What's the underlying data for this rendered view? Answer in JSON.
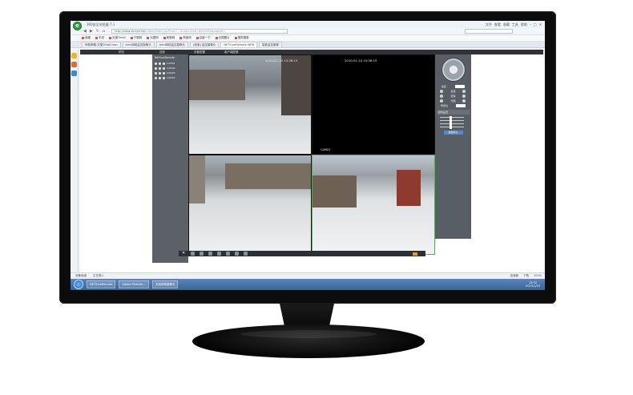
{
  "browser": {
    "title": "360安全浏览器 7.1",
    "window_controls": [
      "文件",
      "查看",
      "收藏",
      "工具",
      "帮助"
    ],
    "url_host": "http://www.smeye.net",
    "url_rest": "/video/index.jsp?mac=...&username=admin&password=",
    "bookmarks": [
      "收藏",
      "手机",
      "天猫Tmall",
      "千图网",
      "大图网",
      "昵图网",
      "淘宝网",
      "百度一下",
      "全国图片",
      "搜狗搜索"
    ],
    "tabs": [
      {
        "label": "网易邮箱-天猫Tmall.com"
      },
      {
        "label": "amu网络监控摄像头"
      },
      {
        "label": "amu网络监控摄像头"
      },
      {
        "label": "[淘宝] 监控摄像头"
      },
      {
        "label": "NETSureRemote WEB",
        "active": true
      },
      {
        "label": "智能监控摄像"
      }
    ]
  },
  "app": {
    "menu": [
      "预览",
      "回放",
      "设备配置",
      "客户端配置"
    ],
    "device_tree": {
      "root": "NetSureRemote",
      "cameras": [
        "CAM01",
        "CAM02",
        "CAM03",
        "CAM04"
      ]
    },
    "cameras": [
      {
        "name": "CAM01",
        "time": "2010-01-10 15:36:15"
      },
      {
        "name": "CAM02",
        "time": "2010-01-10 15:36:15"
      },
      {
        "name": "CAM03",
        "time": ""
      },
      {
        "name": "CAM04",
        "time": ""
      }
    ],
    "ptz": {
      "zoom_label": "变倍",
      "focus_label": "聚焦",
      "iris_label": "光圈",
      "speed_label": "速度",
      "preset_label": "预置位",
      "color_section": "颜色设置",
      "restore_button": "恢复默认"
    }
  },
  "statusbar": {
    "left": [
      "准备就绪",
      "正在载入"
    ],
    "right": [
      "加速器",
      "下载",
      "100%"
    ]
  },
  "taskbar": {
    "items": [
      "NETSureRemote",
      "Adobe Photosh...",
      "无线网络摄像头"
    ],
    "time": "15:32",
    "date": "2015/1/10"
  },
  "colors": {
    "bezel": "#0c0c0c",
    "selection": "#39c23d",
    "taskbar": "#3a639a",
    "browser_logo": "#2e9e3a"
  }
}
